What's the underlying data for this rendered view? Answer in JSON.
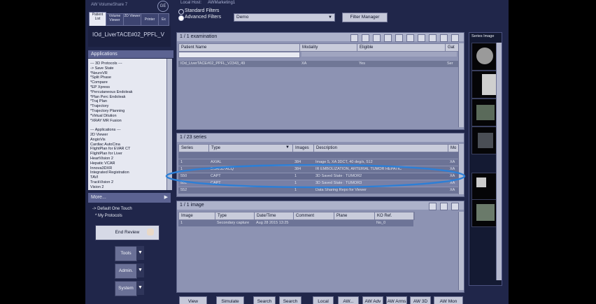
{
  "window": {
    "title": "AW VolumeShare 7",
    "brand": "GE",
    "local_host_label": "Local Host:",
    "local_host_value": "AWMarketing1"
  },
  "top_tabs": [
    "Patient List",
    "Volume Viewer",
    "2D Viewer",
    "Printer",
    "Ex"
  ],
  "patient_title": "IOd_LiverTACE#02_PPFL_V",
  "filters": {
    "standard": "Standard Filters",
    "advanced": "Advanced Filters",
    "selected_value": "Demo",
    "manager_button": "Filter Manager"
  },
  "sidebar": {
    "applications_header": "Applications",
    "items": [
      "--- 3D Protocols ---",
      "-> Save State",
      "*NeuroVR",
      "*Split Phase",
      "*Compare",
      "*EP Xpress",
      "*Percutaneous Endoleak",
      "*Plan Perc Endoleak",
      "*Traj Plan",
      "*Trajectory",
      "*Trajectory Planning",
      "*Virtual Dilution",
      "*XRAY MR Fusion",
      "",
      "--- Applications ---",
      "2D Viewer",
      "AngioVis",
      "Cardiac AutoCina",
      "FlightPlan for EVAR CT",
      "FlightPlan for Liver",
      "HeartVision 2",
      "Hepatic VCAR",
      "Innova3DXR",
      "Integrated Registration",
      "TAVI",
      "TrackVision 2",
      "Vision 2"
    ],
    "more_label": "More...",
    "default_one_touch": "Default One Touch",
    "my_protocols": "My Protocols",
    "end_review": "End Review",
    "tools": "Tools",
    "admin": "Admin.",
    "system": "System"
  },
  "exam_panel": {
    "title": "1 / 1 examination",
    "columns": [
      "Patient Name",
      "Modality",
      "Eligible",
      "Gat"
    ],
    "rows": [
      [
        "IOd_LiverTACE#02_PPFL_V2343_49",
        "XA",
        "Yes",
        "Ser"
      ]
    ]
  },
  "series_panel": {
    "title": "1 / 23 series",
    "columns": [
      "Series",
      "Type",
      "Images",
      "Description",
      "Mo"
    ],
    "rows": [
      [
        "",
        "",
        "",
        "",
        ""
      ],
      [
        "1",
        "AXIAL",
        "384",
        "Image 5, XA 3DCT, 40 deg/s, 512",
        "XA"
      ],
      [
        "1",
        "DSA/3D ACQ",
        "384",
        "IR EMBOLIZATION, ARTERIAL TUMOR HEPATIC",
        "XA"
      ],
      [
        "550",
        "CAPT",
        "1",
        "3D Saved State : TUMOR2",
        "XA"
      ],
      [
        "551",
        "CAPT",
        "1",
        "3D Saved State : TUMOR3",
        "XA"
      ],
      [
        "552",
        "",
        "1",
        "Data Sharing Repo for Viewer",
        "XA"
      ]
    ]
  },
  "image_panel": {
    "title": "1 / 1 image",
    "columns": [
      "Image",
      "Type",
      "Date/Time",
      "Comment",
      "Plane",
      "KO Ref."
    ],
    "rows": [
      [
        "1",
        "Secondary capture",
        "Aug 28 2015 13:25",
        "",
        "",
        "No_0"
      ]
    ]
  },
  "series_image_header": "Series Image",
  "bottom_buttons": [
    "View",
    "Simulate",
    "Search",
    "Search",
    "Local",
    "AW...",
    "AW Adv",
    "AW Arms",
    "AW 3D",
    "AW Mon"
  ]
}
